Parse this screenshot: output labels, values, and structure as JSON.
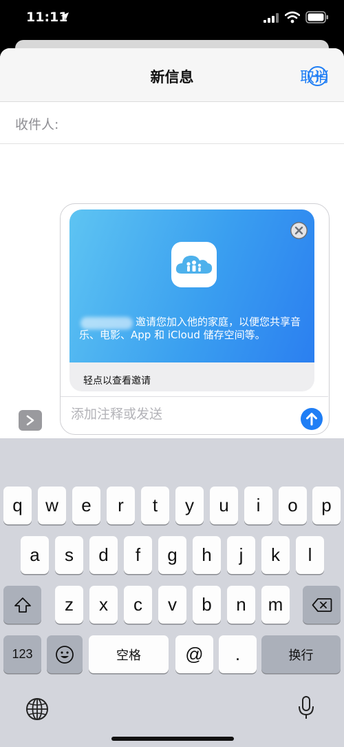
{
  "status": {
    "time": "11:11"
  },
  "nav": {
    "title": "新信息",
    "cancel": "取消"
  },
  "recipient": {
    "label": "收件人:"
  },
  "invite": {
    "message": "邀请您加入他的家庭，以便您共享音乐、电影、App 和 iCloud 储存空间等。",
    "footer": "轻点以查看邀请"
  },
  "composer": {
    "placeholder": "添加注释或发送"
  },
  "keyboard": {
    "row1": [
      "q",
      "w",
      "e",
      "r",
      "t",
      "y",
      "u",
      "i",
      "o",
      "p"
    ],
    "row2": [
      "a",
      "s",
      "d",
      "f",
      "g",
      "h",
      "j",
      "k",
      "l"
    ],
    "row3": [
      "z",
      "x",
      "c",
      "v",
      "b",
      "n",
      "m"
    ],
    "num_label": "123",
    "space_label": "空格",
    "at_label": "@",
    "dot_label": ".",
    "return_label": "换行"
  },
  "colors": {
    "accent": "#1f7ef5",
    "card_gradient_start": "#5ec4f2",
    "card_gradient_end": "#2b7ff0"
  }
}
